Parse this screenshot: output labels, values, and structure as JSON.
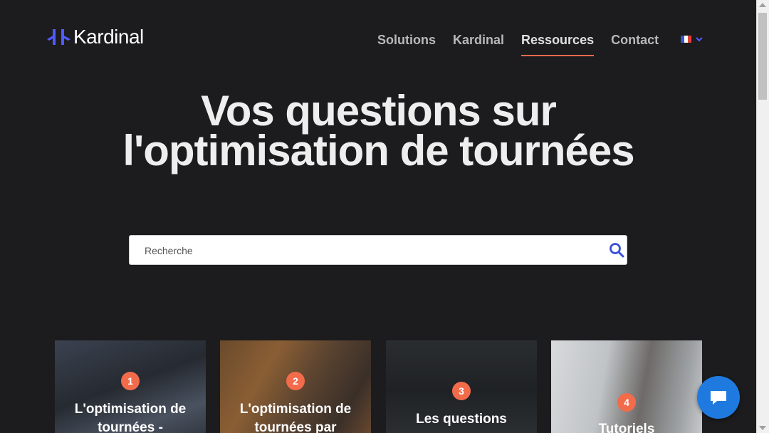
{
  "brand": {
    "name": "Kardinal"
  },
  "nav": {
    "items": [
      {
        "label": "Solutions",
        "active": false
      },
      {
        "label": "Kardinal",
        "active": false
      },
      {
        "label": "Ressources",
        "active": true
      },
      {
        "label": "Contact",
        "active": false
      }
    ],
    "language_icon": "french-flag-icon"
  },
  "hero": {
    "title_line1": "Vos questions sur",
    "title_line2": "l'optimisation de tournées"
  },
  "search": {
    "placeholder": "Recherche",
    "value": "",
    "icon": "search-icon"
  },
  "cards": [
    {
      "number": "1",
      "title_line1": "L'optimisation de",
      "title_line2": "tournées -"
    },
    {
      "number": "2",
      "title_line1": "L'optimisation de",
      "title_line2": "tournées par"
    },
    {
      "number": "3",
      "title_line1": "Les questions",
      "title_line2": ""
    },
    {
      "number": "4",
      "title_line1": "Tutoriels",
      "title_line2": ""
    }
  ],
  "colors": {
    "accent": "#f26b4b",
    "brand_blue": "#4f5bff",
    "chat_blue": "#1f7ae0",
    "background": "#1c1b1d"
  },
  "chat": {
    "icon": "chat-bubble-icon"
  }
}
